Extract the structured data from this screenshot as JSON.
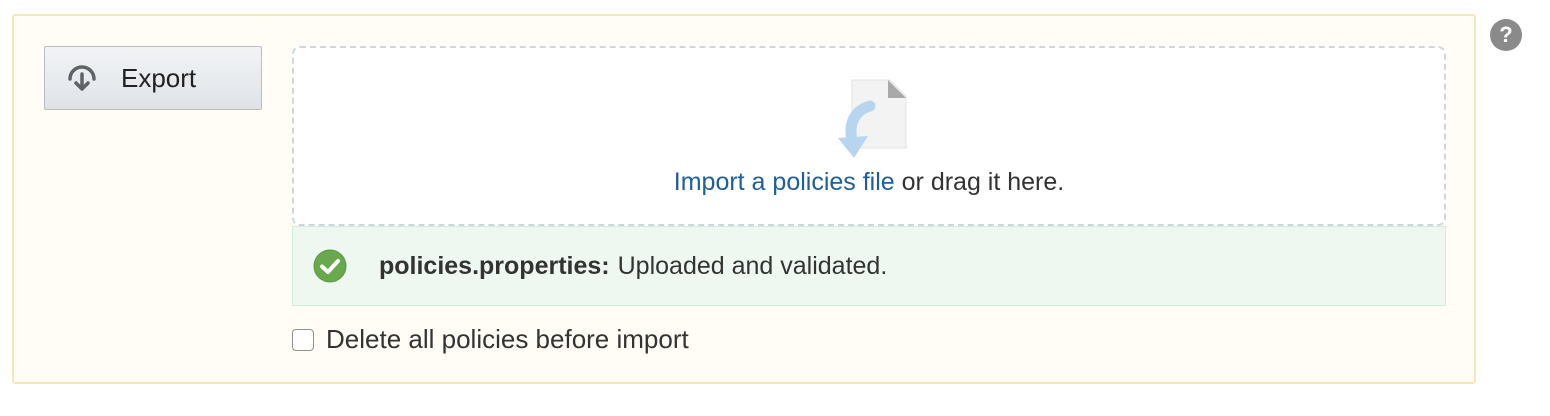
{
  "export": {
    "label": "Export",
    "icon": "download-icon"
  },
  "import": {
    "link_text": "Import a policies file",
    "rest_text": " or drag it here.",
    "icon": "file-download-icon"
  },
  "status": {
    "file_name": "policies.properties:",
    "message": "Uploaded and validated.",
    "icon": "check-circle-icon",
    "color": "#6aa84f"
  },
  "options": {
    "delete_all_label": "Delete all policies before import",
    "delete_all_checked": false
  },
  "help": {
    "icon": "help-icon",
    "glyph": "?"
  },
  "colors": {
    "panel_bg": "#fffdf6",
    "panel_border": "#f6e7b6",
    "link": "#1f5e96",
    "success_bg": "#eef8f1"
  }
}
